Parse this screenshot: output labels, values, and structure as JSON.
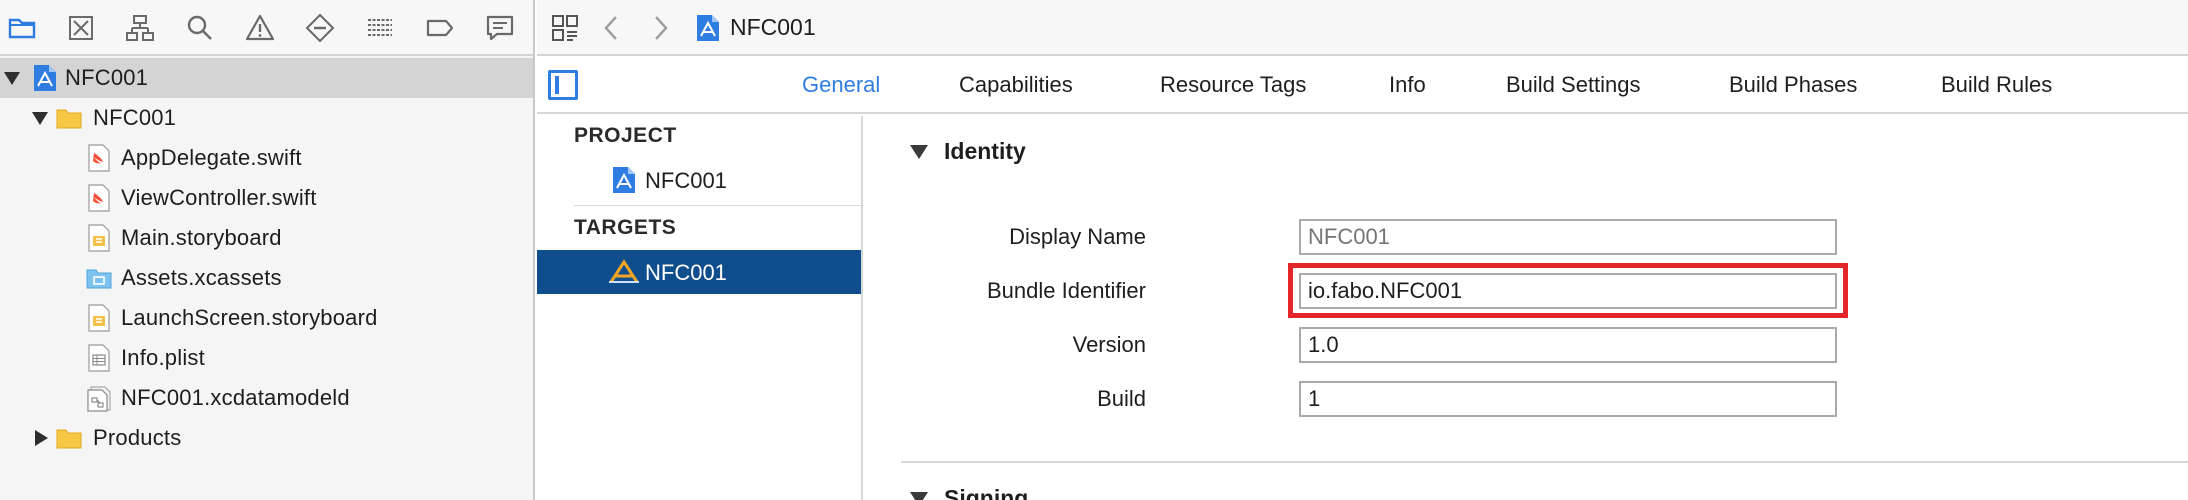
{
  "navigator": {
    "toolbar_icons": [
      "folder-icon",
      "source-control-icon",
      "hierarchy-icon",
      "search-icon",
      "warning-icon",
      "test-icon",
      "debug-icon",
      "breakpoint-icon",
      "report-icon"
    ],
    "tree": [
      {
        "label": "NFC001",
        "icon": "xcode-project-icon",
        "expanded": true,
        "selected": true
      },
      {
        "label": "NFC001",
        "icon": "folder-icon",
        "expanded": true
      },
      {
        "label": "AppDelegate.swift",
        "icon": "swift-file-icon"
      },
      {
        "label": "ViewController.swift",
        "icon": "swift-file-icon"
      },
      {
        "label": "Main.storyboard",
        "icon": "storyboard-icon"
      },
      {
        "label": "Assets.xcassets",
        "icon": "asset-folder-icon"
      },
      {
        "label": "LaunchScreen.storyboard",
        "icon": "storyboard-icon"
      },
      {
        "label": "Info.plist",
        "icon": "plist-icon"
      },
      {
        "label": "NFC001.xcdatamodeld",
        "icon": "datamodel-icon"
      },
      {
        "label": "Products",
        "icon": "folder-icon",
        "expanded": false
      }
    ]
  },
  "jumpbar": {
    "title": "NFC001"
  },
  "tabs": [
    {
      "label": "General",
      "active": true
    },
    {
      "label": "Capabilities"
    },
    {
      "label": "Resource Tags"
    },
    {
      "label": "Info"
    },
    {
      "label": "Build Settings"
    },
    {
      "label": "Build Phases"
    },
    {
      "label": "Build Rules"
    }
  ],
  "project_list": {
    "project_header": "PROJECT",
    "project_item": "NFC001",
    "targets_header": "TARGETS",
    "target_item": "NFC001"
  },
  "identity": {
    "heading": "Identity",
    "display_name_label": "Display Name",
    "display_name_placeholder": "NFC001",
    "bundle_id_label": "Bundle Identifier",
    "bundle_id_value": "io.fabo.NFC001",
    "version_label": "Version",
    "version_value": "1.0",
    "build_label": "Build",
    "build_value": "1"
  },
  "signing": {
    "heading": "Signing"
  },
  "colors": {
    "accent": "#2f7de1",
    "selection": "#0f4d8c",
    "highlight": "#e3262a"
  }
}
